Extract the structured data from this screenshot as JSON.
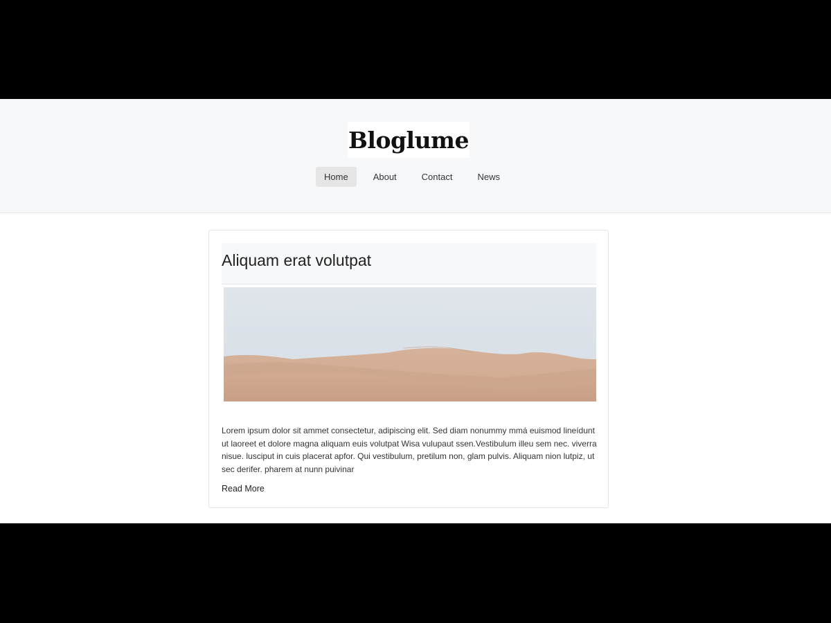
{
  "header": {
    "logo_text": "Bloglume",
    "nav": [
      {
        "label": "Home",
        "active": true
      },
      {
        "label": "About",
        "active": false
      },
      {
        "label": "Contact",
        "active": false
      },
      {
        "label": "News",
        "active": false
      }
    ]
  },
  "post": {
    "title": "Aliquam erat volutpat",
    "image_subject": "desert sand dunes",
    "excerpt": "Lorem ipsum dolor sit ammet consectetur, adipiscing elit. Sed diam nonummy mmá euismod lineídunt ut laoreet et dolore magna aliquam euis volutpat Wisa vulupaut ssen.Vestibulum illeu sem nec. viverra nisue. lusciput in cuis placerat apfor. Qui vestibulum, pretilum non, glam pulvis. Aliquam nion lutpiz, ut sec derifer. pharem at nunn puivinar",
    "read_more_label": "Read More"
  },
  "colors": {
    "page_letterbox": "#000000",
    "header_bg": "#f7f8f9",
    "nav_active_bg": "#e6e6e6",
    "sky": "#dde4ea",
    "sand": "#d4ab92"
  }
}
